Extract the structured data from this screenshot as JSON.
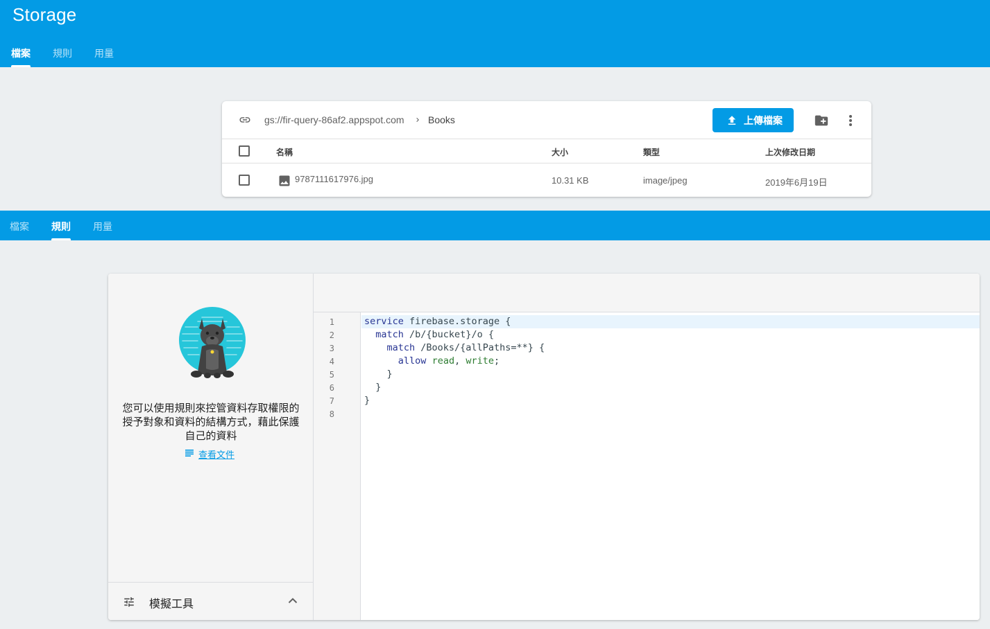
{
  "header": {
    "title": "Storage",
    "tabs": [
      "檔案",
      "規則",
      "用量"
    ],
    "active_tab": "檔案"
  },
  "files": {
    "bucket_path": "gs://fir-query-86af2.appspot.com",
    "current_folder": "Books",
    "upload_label": "上傳檔案",
    "columns": {
      "name": "名稱",
      "size": "大小",
      "type": "類型",
      "modified": "上次修改日期"
    },
    "rows": [
      {
        "name": "9787111617976.jpg",
        "size": "10.31 KB",
        "type": "image/jpeg",
        "modified": "2019年6月19日"
      }
    ]
  },
  "rules_section": {
    "tabs": [
      "檔案",
      "規則",
      "用量"
    ],
    "active_tab": "規則",
    "intro_text": "您可以使用規則來控管資料存取權限的授予對象和資料的結構方式，藉此保護自己的資料",
    "docs_link": "查看文件",
    "simulator_label": "模擬工具",
    "line_numbers": [
      "1",
      "2",
      "3",
      "4",
      "5",
      "6",
      "7",
      "8"
    ],
    "code_lines": [
      "service firebase.storage {",
      "  match /b/{bucket}/o {",
      "    match /Books/{allPaths=**} {",
      "      allow read, write;",
      "    }",
      "  }",
      "}",
      ""
    ]
  },
  "colors": {
    "brand_blue": "#039be5",
    "background": "#eceff1",
    "keyword": "#283593",
    "permission": "#2e7d32"
  },
  "icons": [
    "link-icon",
    "chevron-right-icon",
    "upload-icon",
    "new-folder-icon",
    "more-vert-icon",
    "image-file-icon",
    "document-icon",
    "tune-icon",
    "chevron-up-icon",
    "dog-mascot-illustration"
  ]
}
